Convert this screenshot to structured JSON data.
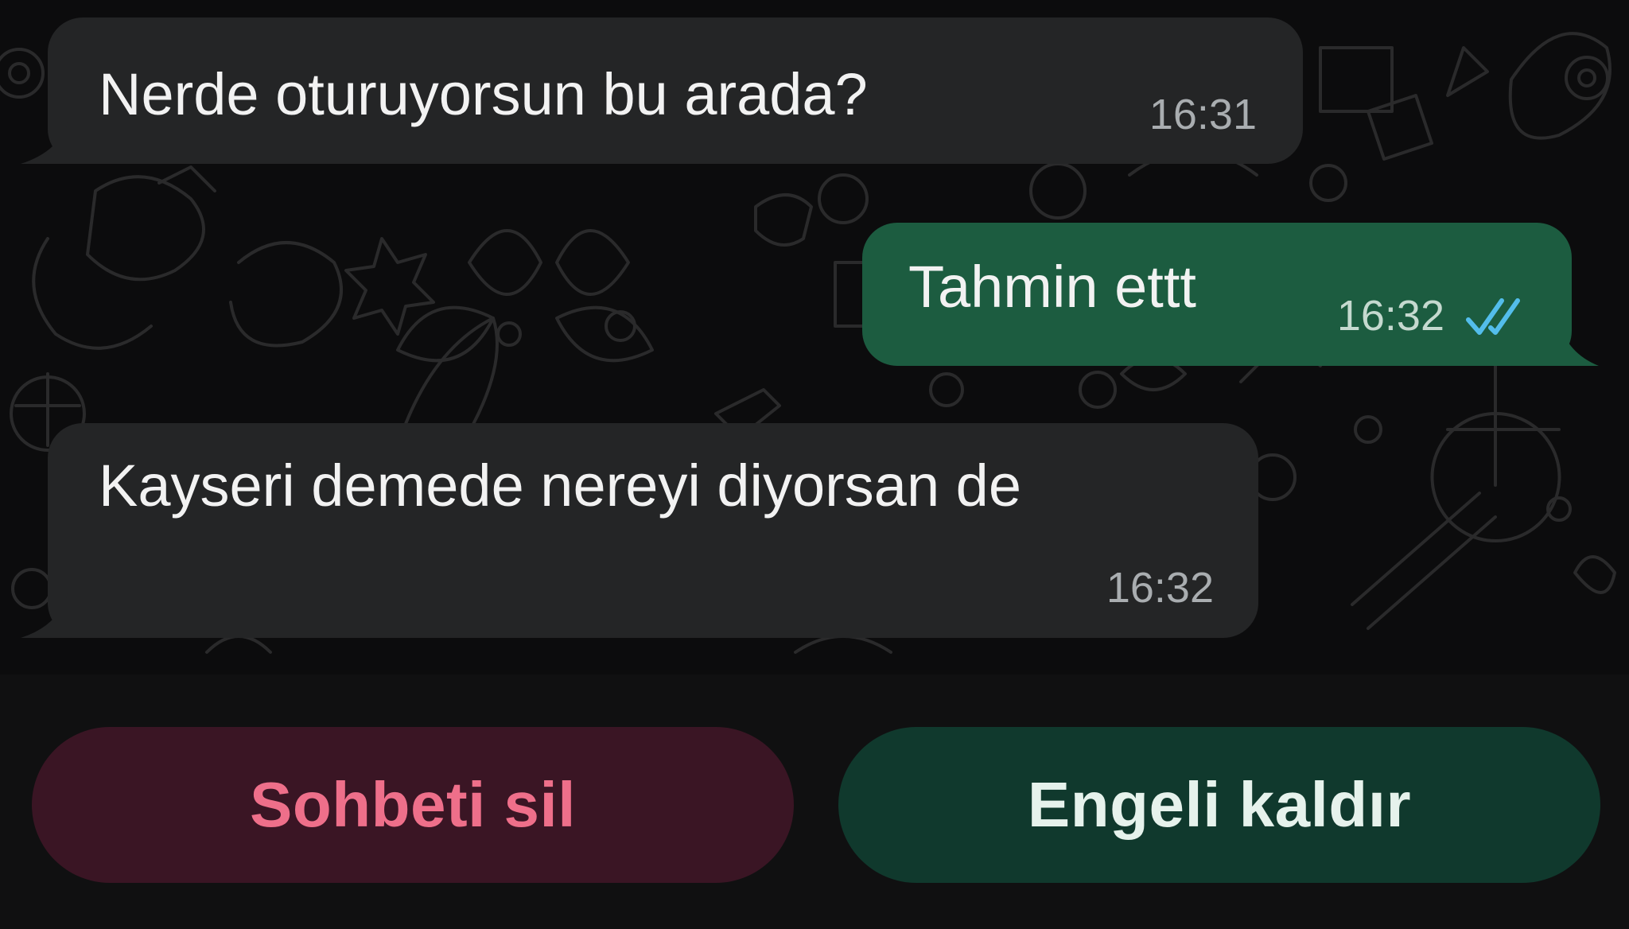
{
  "messages": [
    {
      "direction": "incoming",
      "text": "Nerde oturuyorsun bu arada?",
      "time": "16:31"
    },
    {
      "direction": "outgoing",
      "text": "Tahmin ettt",
      "time": "16:32",
      "status": "read",
      "status_icon": "double-check-icon"
    },
    {
      "direction": "incoming",
      "text": "Kayseri demede nereyi diyorsan de",
      "time": "16:32"
    }
  ],
  "actions": {
    "delete_chat_label": "Sohbeti sil",
    "unblock_label": "Engeli kaldır"
  },
  "colors": {
    "incoming_bubble": "#242526",
    "outgoing_bubble": "#1c5c40",
    "read_ticks": "#53bdeb",
    "delete_button_bg": "#3a1524",
    "delete_button_text": "#ee6f8a",
    "unblock_button_bg": "#10392d",
    "unblock_button_text": "#e6f2ec"
  }
}
